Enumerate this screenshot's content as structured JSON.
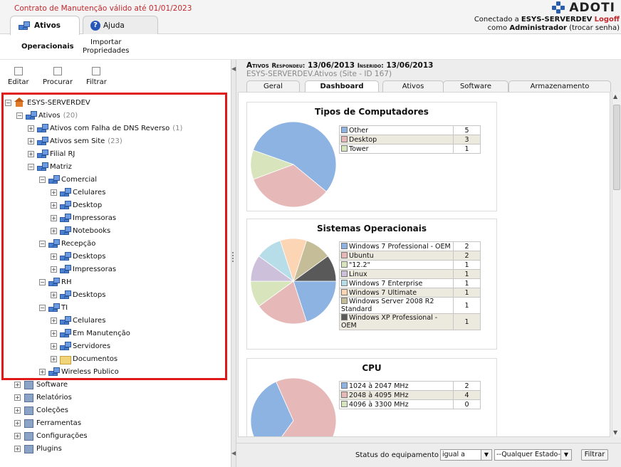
{
  "header": {
    "contract": "Contrato de Manutenção válido até 01/01/2023",
    "logo": "ADOTI",
    "connected_prefix": "Conectado a ",
    "server": "ESYS-SERVERDEV",
    "logoff": "Logoff",
    "as_prefix": "como ",
    "user": "Administrador",
    "change_password": " (trocar senha)"
  },
  "main_tabs": [
    {
      "label": "Ativos"
    },
    {
      "label": "Ajuda"
    }
  ],
  "subnav": {
    "operational": "Operacionais",
    "import_line1": "Importar",
    "import_line2": "Propriedades"
  },
  "toolbar": {
    "edit": "Editar",
    "search": "Procurar",
    "filter": "Filtrar"
  },
  "tree": [
    {
      "label": "ESYS-SERVERDEV",
      "count": ""
    },
    {
      "label": "Ativos",
      "count": "(20)"
    },
    {
      "label": "Ativos com Falha de DNS Reverso",
      "count": "(1)"
    },
    {
      "label": "Ativos sem Site",
      "count": "(23)"
    },
    {
      "label": "Filial RJ",
      "count": ""
    },
    {
      "label": "Matriz",
      "count": ""
    },
    {
      "label": "Comercial",
      "count": ""
    },
    {
      "label": "Celulares",
      "count": ""
    },
    {
      "label": "Desktop",
      "count": ""
    },
    {
      "label": "Impressoras",
      "count": ""
    },
    {
      "label": "Notebooks",
      "count": ""
    },
    {
      "label": "Recepção",
      "count": ""
    },
    {
      "label": "Desktops",
      "count": ""
    },
    {
      "label": "Impressoras",
      "count": ""
    },
    {
      "label": "RH",
      "count": ""
    },
    {
      "label": "Desktops",
      "count": ""
    },
    {
      "label": "TI",
      "count": ""
    },
    {
      "label": "Celulares",
      "count": ""
    },
    {
      "label": "Em Manutenção",
      "count": ""
    },
    {
      "label": "Servidores",
      "count": ""
    },
    {
      "label": "Documentos",
      "count": ""
    },
    {
      "label": "Wireless Publico",
      "count": ""
    }
  ],
  "bottom_tree": [
    {
      "label": "Software"
    },
    {
      "label": "Relatórios"
    },
    {
      "label": "Coleções"
    },
    {
      "label": "Ferramentas"
    },
    {
      "label": "Configurações"
    },
    {
      "label": "Plugins"
    }
  ],
  "asset": {
    "title": "Ativos",
    "responded_label": "Respondeu:",
    "responded": "13/06/2013",
    "inserted_label": "Inserido:",
    "inserted": "13/06/2013",
    "subtitle": "ESYS-SERVERDEV.Ativos  (Site - ID 167)"
  },
  "asset_tabs": [
    {
      "label": "Geral"
    },
    {
      "label": "Dashboard"
    },
    {
      "label": "Ativos"
    },
    {
      "label": "Software"
    },
    {
      "label": "Armazenamento"
    }
  ],
  "status_bar": {
    "label": "Status do equipamento",
    "operator": "igual a",
    "state": "--Qualquer Estado--",
    "filter_button": "Filtrar"
  },
  "chart_data": [
    {
      "type": "pie",
      "title": "Tipos de Computadores",
      "categories": [
        "Other",
        "Desktop",
        "Tower"
      ],
      "values": [
        5,
        3,
        1
      ],
      "colors": [
        "#8db3e2",
        "#e6b9b8",
        "#d7e4bc"
      ]
    },
    {
      "type": "pie",
      "title": "Sistemas Operacionais",
      "categories": [
        "Windows 7 Professional - OEM",
        "Ubuntu",
        "\"12.2\"",
        "Linux",
        "Windows 7 Enterprise",
        "Windows 7 Ultimate",
        "Windows Server 2008 R2 Standard",
        "Windows XP Professional - OEM"
      ],
      "values": [
        2,
        2,
        1,
        1,
        1,
        1,
        1,
        1
      ],
      "colors": [
        "#8db3e2",
        "#e6b9b8",
        "#d7e4bc",
        "#ccc0da",
        "#b7dde8",
        "#fcd5b4",
        "#c4bd97",
        "#595959"
      ]
    },
    {
      "type": "pie",
      "title": "CPU",
      "categories": [
        "1024 à 2047 MHz",
        "2048 à 4095 MHz",
        "4096 à 3300 MHz"
      ],
      "values": [
        2,
        4,
        0
      ],
      "colors": [
        "#8db3e2",
        "#e6b9b8",
        "#d7e4bc"
      ]
    }
  ]
}
